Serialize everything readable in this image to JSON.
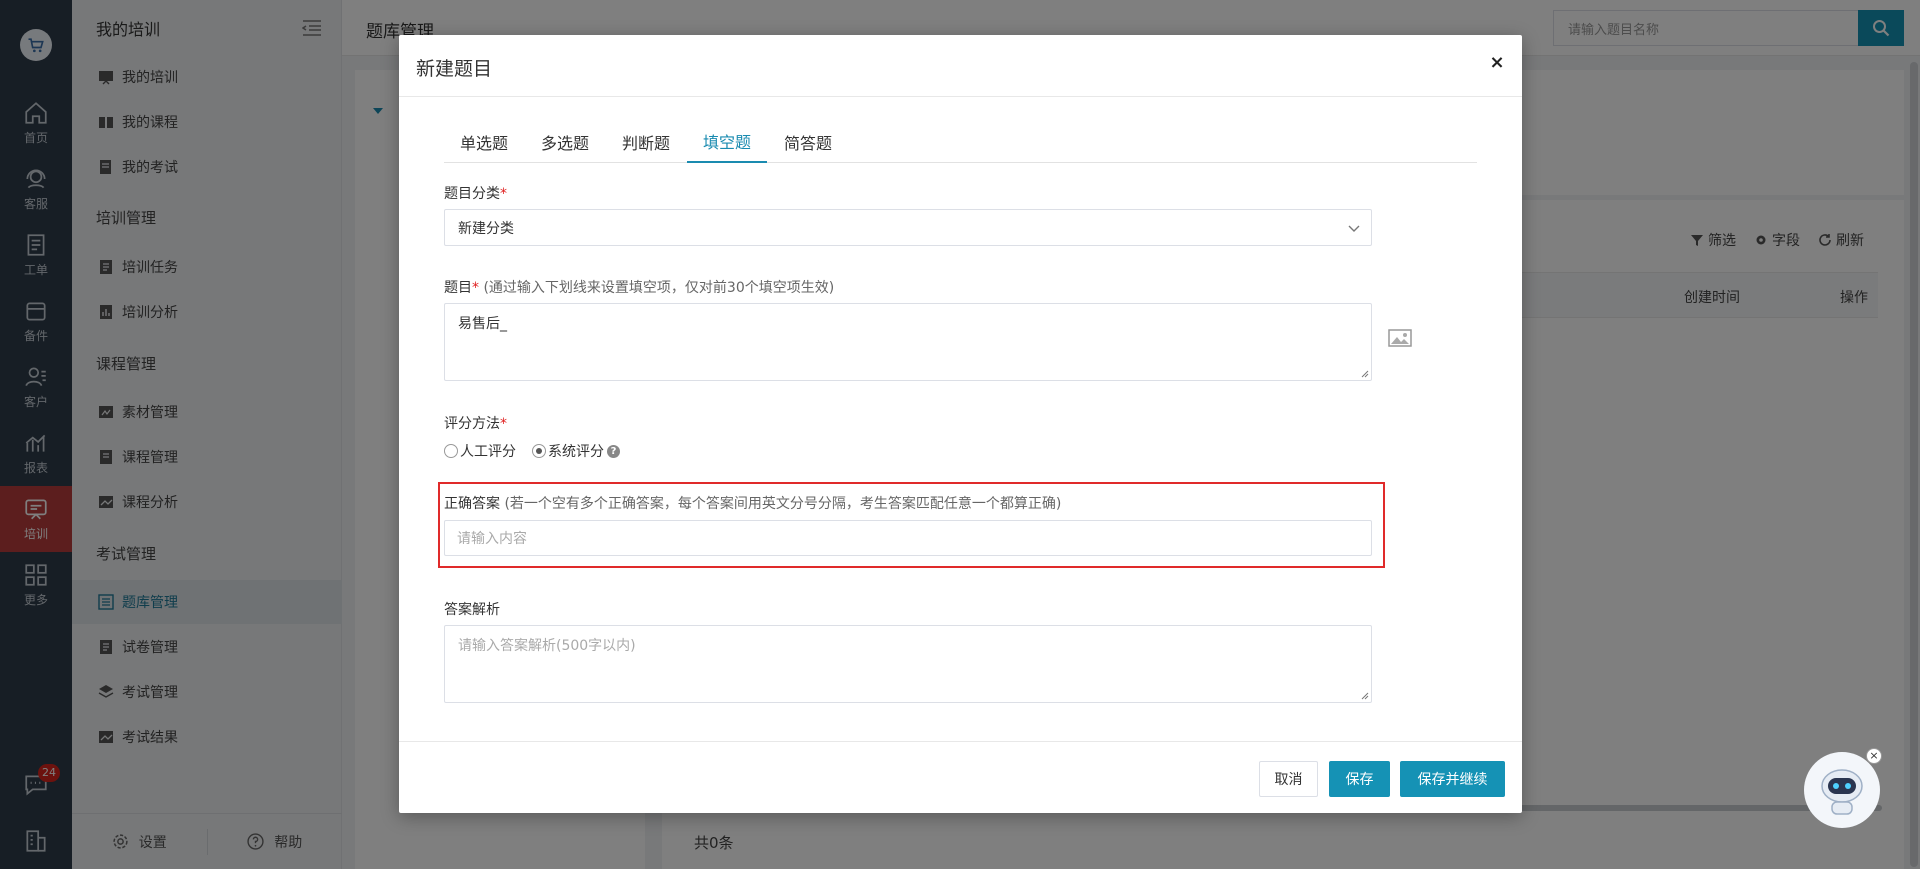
{
  "nav_rail": {
    "items": [
      {
        "label": "首页",
        "icon": "home-icon"
      },
      {
        "label": "客服",
        "icon": "headset-icon"
      },
      {
        "label": "工单",
        "icon": "clipboard-icon"
      },
      {
        "label": "备件",
        "icon": "box-icon"
      },
      {
        "label": "客户",
        "icon": "users-icon"
      },
      {
        "label": "报表",
        "icon": "chart-icon"
      },
      {
        "label": "培训",
        "icon": "training-icon",
        "active": true
      },
      {
        "label": "更多",
        "icon": "grid-icon"
      }
    ],
    "message_badge": "24"
  },
  "sidebar": {
    "title": "我的培训",
    "groups": [
      {
        "title": "",
        "items": [
          "我的培训",
          "我的课程",
          "我的考试"
        ]
      },
      {
        "title": "培训管理",
        "items": [
          "培训任务",
          "培训分析"
        ]
      },
      {
        "title": "课程管理",
        "items": [
          "素材管理",
          "课程管理",
          "课程分析"
        ]
      },
      {
        "title": "考试管理",
        "items": [
          "题库管理",
          "试卷管理",
          "考试管理",
          "考试结果"
        ]
      }
    ],
    "footer": {
      "settings": "设置",
      "help": "帮助"
    }
  },
  "header": {
    "page_title": "题库管理",
    "search_placeholder": "请输入题目名称"
  },
  "list": {
    "tools": [
      "筛选",
      "字段",
      "刷新"
    ],
    "columns": [
      "创建时间",
      "操作"
    ],
    "total": "共0条"
  },
  "dialog": {
    "title": "新建题目",
    "close": "×",
    "tabs": [
      "单选题",
      "多选题",
      "判断题",
      "填空题",
      "简答题"
    ],
    "active_tab": "填空题",
    "category": {
      "label": "题目分类",
      "required": "*",
      "value": "新建分类"
    },
    "question": {
      "label": "题目",
      "required": "*",
      "hint": "(通过输入下划线来设置填空项，仅对前30个填空项生效)",
      "value": "易售后_"
    },
    "scoring": {
      "label": "评分方法",
      "required": "*",
      "options": [
        "人工评分",
        "系统评分"
      ],
      "selected": "系统评分"
    },
    "answer": {
      "label": "正确答案",
      "hint": "(若一个空有多个正确答案，每个答案间用英文分号分隔，考生答案匹配任意一个都算正确)",
      "placeholder": "请输入内容"
    },
    "analysis": {
      "label": "答案解析",
      "placeholder": "请输入答案解析(500字以内)"
    },
    "buttons": {
      "cancel": "取消",
      "save": "保存",
      "save_continue": "保存并继续"
    }
  },
  "colors": {
    "accent": "#1592b5",
    "active_rail": "#b83c3c",
    "highlight_border": "#e02a2a"
  }
}
